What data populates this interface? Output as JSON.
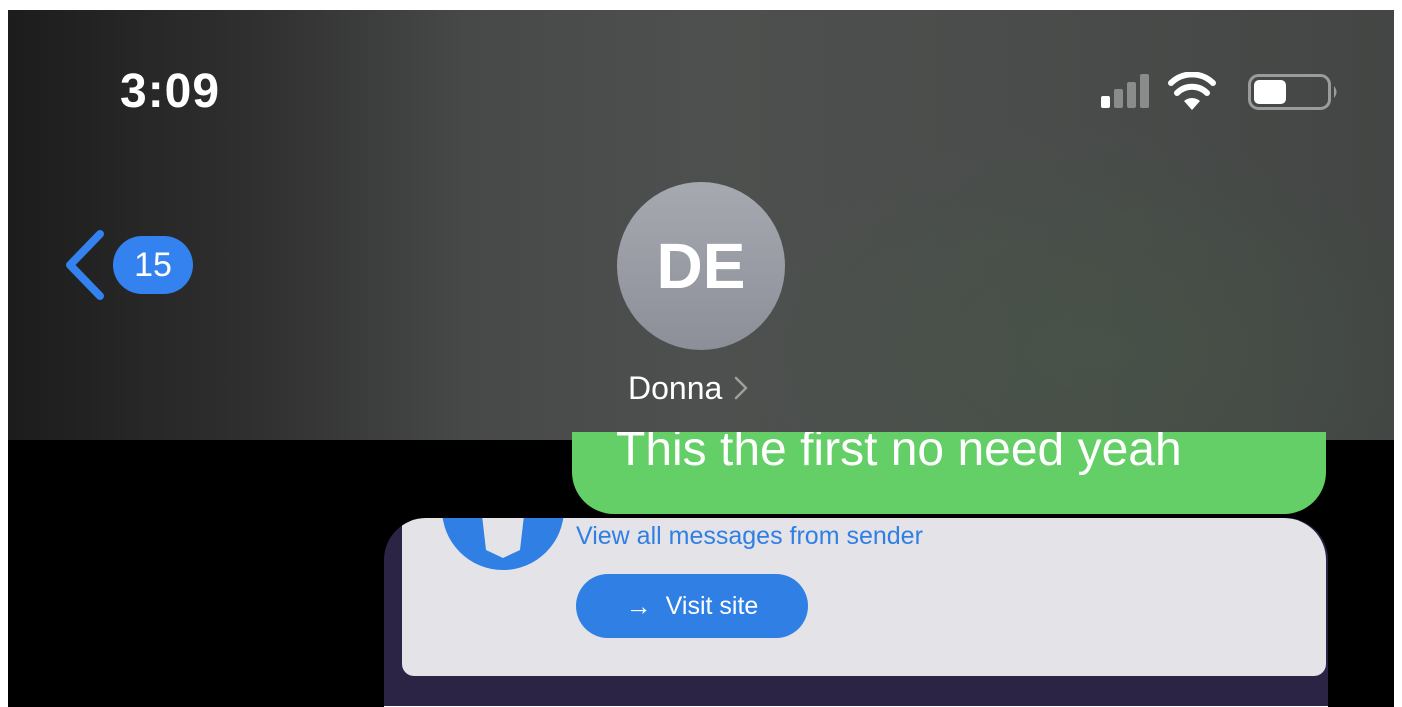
{
  "status_bar": {
    "time": "3:09",
    "icons": [
      "cellular-signal-icon",
      "wifi-icon",
      "battery-icon"
    ],
    "battery_level": 0.45
  },
  "nav": {
    "back_icon": "chevron-left-icon",
    "unread_count": "15",
    "contact_initials": "DE",
    "contact_name": "Donna",
    "contact_chevron_icon": "chevron-right-icon"
  },
  "messages": [
    {
      "type": "sent",
      "text": "This the first no need yeah"
    }
  ],
  "link_preview": {
    "logo_icon": "shield-logo-icon",
    "link_text": "View all messages from sender",
    "button_icon": "arrow-right-icon",
    "button_arrow": "→",
    "button_label": "Visit site"
  },
  "colors": {
    "accent_blue": "#3382f0",
    "sent_bubble_green": "#63cf66",
    "avatar_gray": "#9a9ca4",
    "preview_frame": "#2b2445",
    "preview_card": "#e3e3e8"
  }
}
